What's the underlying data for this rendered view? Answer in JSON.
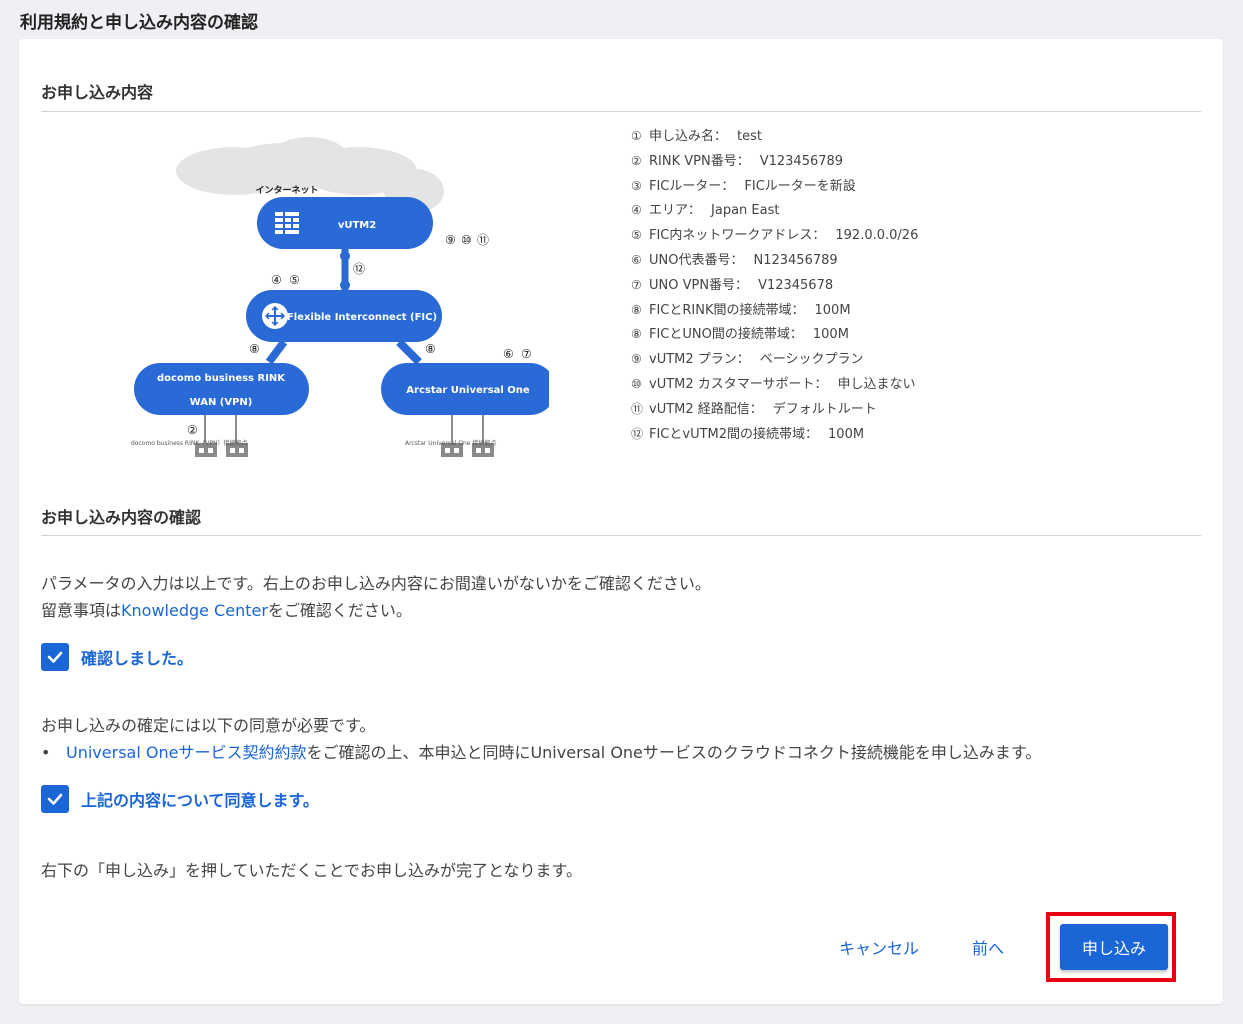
{
  "page_title": "利用規約と申し込み内容の確認",
  "summary": {
    "title": "お申し込み内容",
    "diagram": {
      "internet": "インターネット",
      "vutm": "vUTM2",
      "fic": "Flexible Interconnect (FIC)",
      "rink_line1": "docomo business RINK",
      "rink_line2": "WAN (VPN)",
      "uno": "Arcstar Universal One",
      "rink_site": "docomo business RINK（VPN）接続拠点",
      "uno_site": "Arcstar Universal One 接続拠点",
      "marker_vutm": [
        "⑨",
        "⑩",
        "⑪"
      ],
      "marker_link": "⑫",
      "marker_fic": [
        "④",
        "⑤"
      ],
      "marker_rink_link": "⑧",
      "marker_uno_link": "⑧",
      "marker_uno": [
        "⑥",
        "⑦"
      ],
      "marker_rink_site": "②"
    },
    "details": [
      {
        "num": "①",
        "label": "申し込み名：",
        "value": "test"
      },
      {
        "num": "②",
        "label": "RINK VPN番号：",
        "value": "V123456789"
      },
      {
        "num": "③",
        "label": "FICルーター：",
        "value": "FICルーターを新設"
      },
      {
        "num": "④",
        "label": "エリア：",
        "value": "Japan East"
      },
      {
        "num": "⑤",
        "label": "FIC内ネットワークアドレス：",
        "value": "192.0.0.0/26"
      },
      {
        "num": "⑥",
        "label": "UNO代表番号：",
        "value": "N123456789"
      },
      {
        "num": "⑦",
        "label": "UNO VPN番号：",
        "value": "V12345678"
      },
      {
        "num": "⑧",
        "label": "FICとRINK間の接続帯域：",
        "value": "100M"
      },
      {
        "num": "⑧",
        "label": "FICとUNO間の接続帯域：",
        "value": "100M"
      },
      {
        "num": "⑨",
        "label": "vUTM2 プラン：",
        "value": "ベーシックプラン"
      },
      {
        "num": "⑩",
        "label": "vUTM2 カスタマーサポート：",
        "value": "申し込まない"
      },
      {
        "num": "⑪",
        "label": "vUTM2 経路配信：",
        "value": "デフォルトルート"
      },
      {
        "num": "⑫",
        "label": "FICとvUTM2間の接続帯域：",
        "value": "100M"
      }
    ]
  },
  "confirm": {
    "title": "お申し込み内容の確認",
    "line1": "パラメータの入力は以上です。右上のお申し込み内容にお間違いがないかをご確認ください。",
    "line2_prefix": "留意事項は",
    "line2_link": "Knowledge Center",
    "line2_suffix": "をご確認ください。",
    "check1_label": "確認しました。",
    "consent_intro": "お申し込みの確定には以下の同意が必要です。",
    "bullet_link": "Universal Oneサービス契約約款",
    "bullet_text": "をご確認の上、本申込と同時にUniversal Oneサービスのクラウドコネクト接続機能を申し込みます。",
    "check2_label": "上記の内容について同意します。",
    "final_note": "右下の「申し込み」を押していただくことでお申し込みが完了となります。"
  },
  "buttons": {
    "cancel": "キャンセル",
    "back": "前へ",
    "submit": "申し込み"
  },
  "colors": {
    "accent": "#1a66d6",
    "highlight": "#e60012",
    "diagram_blue": "#2a6ad6"
  }
}
